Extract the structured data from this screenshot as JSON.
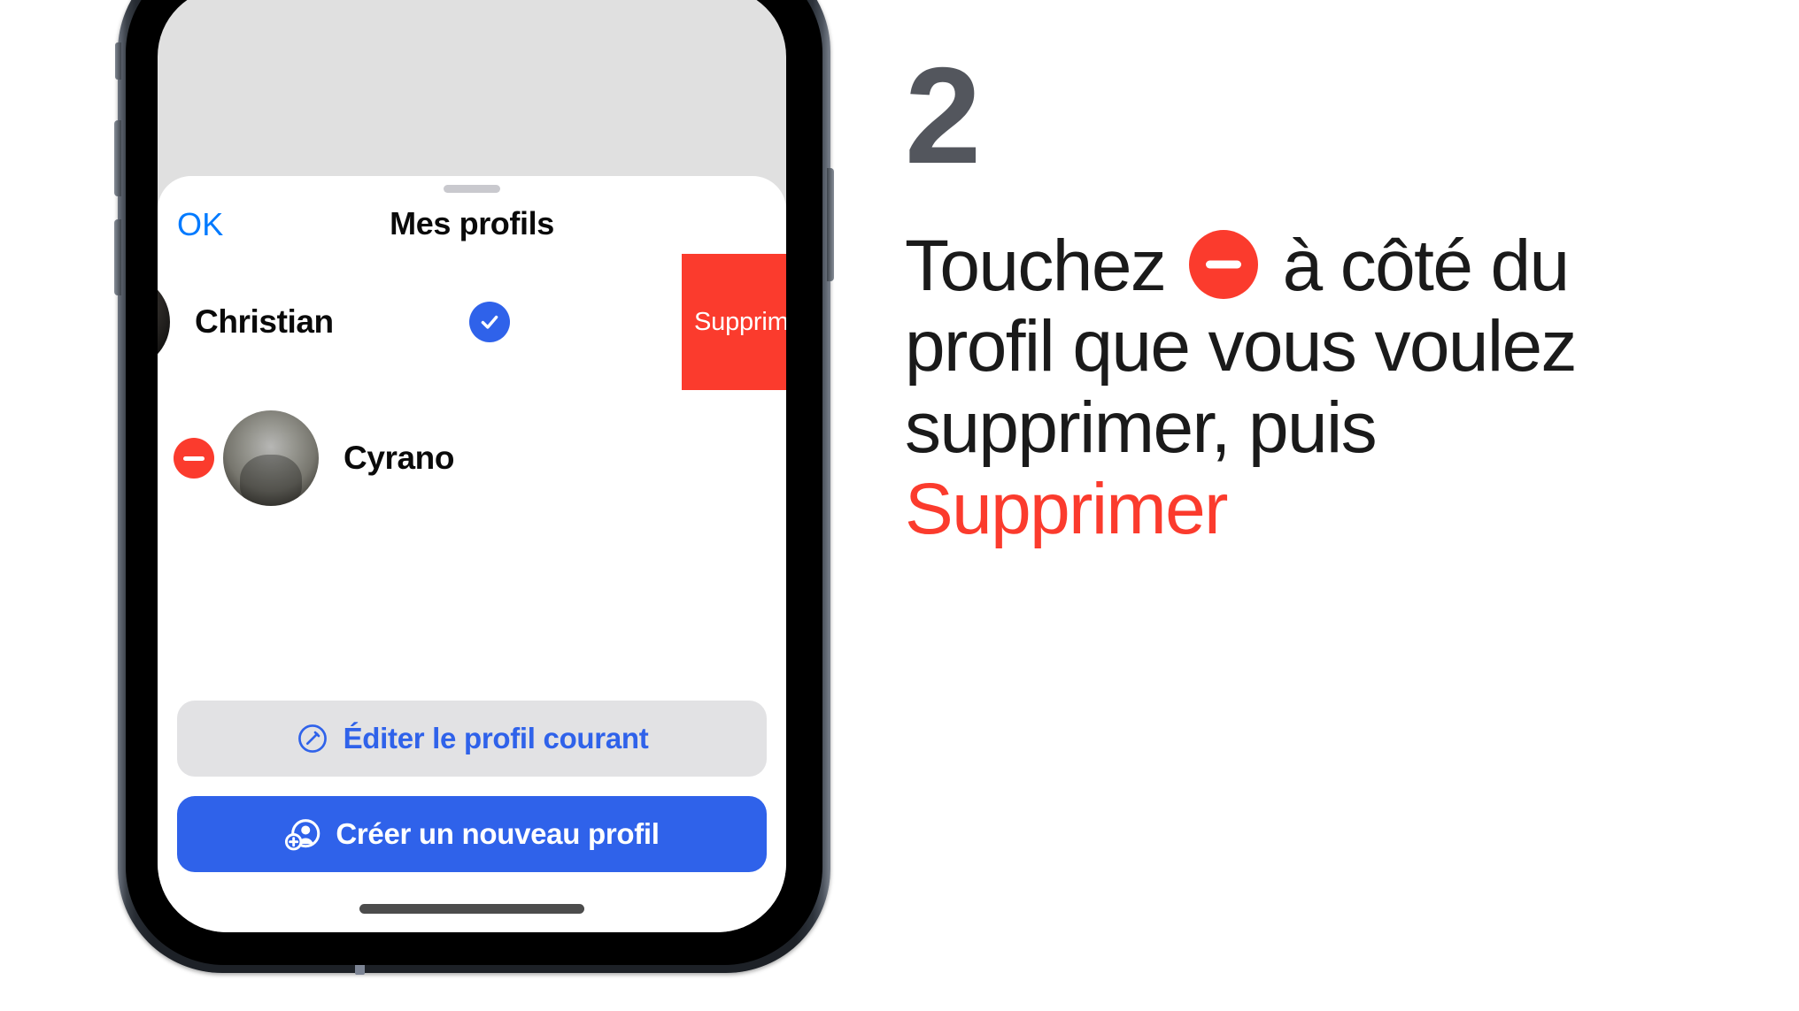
{
  "device": {
    "name": "iphone-mockup",
    "frame_color": "#1d2127",
    "screen_bg": "#e0e0e0"
  },
  "sheet": {
    "nav": {
      "ok_label": "OK",
      "title": "Mes profils"
    },
    "profiles": [
      {
        "name": "Christian",
        "selected": true,
        "swiped": true,
        "avatar": "christian-avatar",
        "swipe_action_label": "Supprimer",
        "swipe_action_color": "#fb3b2d",
        "check_color": "#2f62ea"
      },
      {
        "name": "Cyrano",
        "selected": false,
        "swiped": false,
        "avatar": "cyrano-avatar",
        "remove_icon": "minus-circle-icon",
        "remove_color": "#fb3b2d"
      }
    ],
    "footer": {
      "edit_label": "Éditer le profil courant",
      "edit_icon": "pencil-circle-icon",
      "edit_color": "#2f62ea",
      "create_label": "Créer un nouveau profil",
      "create_icon": "person-badge-plus-icon",
      "create_bg": "#2f62ea"
    }
  },
  "instructions": {
    "step_number": "2",
    "step_number_color": "#53565d",
    "line1_before": "Touchez",
    "inline_icon": "minus-circle-icon",
    "inline_icon_color": "#fb3b2d",
    "line1_after": "à côté du",
    "line2": "profil que vous voulez",
    "line3": "supprimer, puis",
    "line4_emphasis": "Supprimer",
    "emphasis_color": "#fb3b2d"
  }
}
